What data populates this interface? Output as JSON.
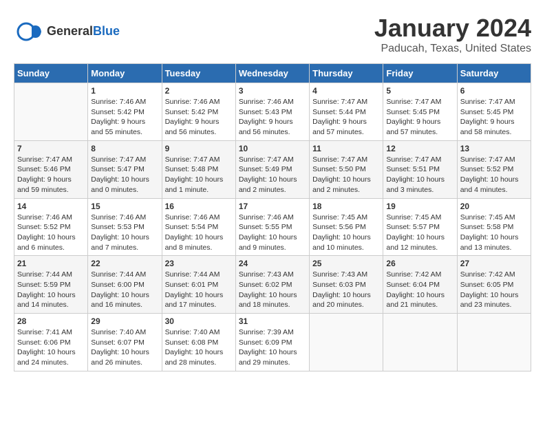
{
  "header": {
    "title": "January 2024",
    "subtitle": "Paducah, Texas, United States",
    "logo_line1": "General",
    "logo_line2": "Blue"
  },
  "days_of_week": [
    "Sunday",
    "Monday",
    "Tuesday",
    "Wednesday",
    "Thursday",
    "Friday",
    "Saturday"
  ],
  "weeks": [
    [
      {
        "date": "",
        "info": ""
      },
      {
        "date": "1",
        "info": "Sunrise: 7:46 AM\nSunset: 5:42 PM\nDaylight: 9 hours\nand 55 minutes."
      },
      {
        "date": "2",
        "info": "Sunrise: 7:46 AM\nSunset: 5:42 PM\nDaylight: 9 hours\nand 56 minutes."
      },
      {
        "date": "3",
        "info": "Sunrise: 7:46 AM\nSunset: 5:43 PM\nDaylight: 9 hours\nand 56 minutes."
      },
      {
        "date": "4",
        "info": "Sunrise: 7:47 AM\nSunset: 5:44 PM\nDaylight: 9 hours\nand 57 minutes."
      },
      {
        "date": "5",
        "info": "Sunrise: 7:47 AM\nSunset: 5:45 PM\nDaylight: 9 hours\nand 57 minutes."
      },
      {
        "date": "6",
        "info": "Sunrise: 7:47 AM\nSunset: 5:45 PM\nDaylight: 9 hours\nand 58 minutes."
      }
    ],
    [
      {
        "date": "7",
        "info": "Sunrise: 7:47 AM\nSunset: 5:46 PM\nDaylight: 9 hours\nand 59 minutes."
      },
      {
        "date": "8",
        "info": "Sunrise: 7:47 AM\nSunset: 5:47 PM\nDaylight: 10 hours\nand 0 minutes."
      },
      {
        "date": "9",
        "info": "Sunrise: 7:47 AM\nSunset: 5:48 PM\nDaylight: 10 hours\nand 1 minute."
      },
      {
        "date": "10",
        "info": "Sunrise: 7:47 AM\nSunset: 5:49 PM\nDaylight: 10 hours\nand 2 minutes."
      },
      {
        "date": "11",
        "info": "Sunrise: 7:47 AM\nSunset: 5:50 PM\nDaylight: 10 hours\nand 2 minutes."
      },
      {
        "date": "12",
        "info": "Sunrise: 7:47 AM\nSunset: 5:51 PM\nDaylight: 10 hours\nand 3 minutes."
      },
      {
        "date": "13",
        "info": "Sunrise: 7:47 AM\nSunset: 5:52 PM\nDaylight: 10 hours\nand 4 minutes."
      }
    ],
    [
      {
        "date": "14",
        "info": "Sunrise: 7:46 AM\nSunset: 5:52 PM\nDaylight: 10 hours\nand 6 minutes."
      },
      {
        "date": "15",
        "info": "Sunrise: 7:46 AM\nSunset: 5:53 PM\nDaylight: 10 hours\nand 7 minutes."
      },
      {
        "date": "16",
        "info": "Sunrise: 7:46 AM\nSunset: 5:54 PM\nDaylight: 10 hours\nand 8 minutes."
      },
      {
        "date": "17",
        "info": "Sunrise: 7:46 AM\nSunset: 5:55 PM\nDaylight: 10 hours\nand 9 minutes."
      },
      {
        "date": "18",
        "info": "Sunrise: 7:45 AM\nSunset: 5:56 PM\nDaylight: 10 hours\nand 10 minutes."
      },
      {
        "date": "19",
        "info": "Sunrise: 7:45 AM\nSunset: 5:57 PM\nDaylight: 10 hours\nand 12 minutes."
      },
      {
        "date": "20",
        "info": "Sunrise: 7:45 AM\nSunset: 5:58 PM\nDaylight: 10 hours\nand 13 minutes."
      }
    ],
    [
      {
        "date": "21",
        "info": "Sunrise: 7:44 AM\nSunset: 5:59 PM\nDaylight: 10 hours\nand 14 minutes."
      },
      {
        "date": "22",
        "info": "Sunrise: 7:44 AM\nSunset: 6:00 PM\nDaylight: 10 hours\nand 16 minutes."
      },
      {
        "date": "23",
        "info": "Sunrise: 7:44 AM\nSunset: 6:01 PM\nDaylight: 10 hours\nand 17 minutes."
      },
      {
        "date": "24",
        "info": "Sunrise: 7:43 AM\nSunset: 6:02 PM\nDaylight: 10 hours\nand 18 minutes."
      },
      {
        "date": "25",
        "info": "Sunrise: 7:43 AM\nSunset: 6:03 PM\nDaylight: 10 hours\nand 20 minutes."
      },
      {
        "date": "26",
        "info": "Sunrise: 7:42 AM\nSunset: 6:04 PM\nDaylight: 10 hours\nand 21 minutes."
      },
      {
        "date": "27",
        "info": "Sunrise: 7:42 AM\nSunset: 6:05 PM\nDaylight: 10 hours\nand 23 minutes."
      }
    ],
    [
      {
        "date": "28",
        "info": "Sunrise: 7:41 AM\nSunset: 6:06 PM\nDaylight: 10 hours\nand 24 minutes."
      },
      {
        "date": "29",
        "info": "Sunrise: 7:40 AM\nSunset: 6:07 PM\nDaylight: 10 hours\nand 26 minutes."
      },
      {
        "date": "30",
        "info": "Sunrise: 7:40 AM\nSunset: 6:08 PM\nDaylight: 10 hours\nand 28 minutes."
      },
      {
        "date": "31",
        "info": "Sunrise: 7:39 AM\nSunset: 6:09 PM\nDaylight: 10 hours\nand 29 minutes."
      },
      {
        "date": "",
        "info": ""
      },
      {
        "date": "",
        "info": ""
      },
      {
        "date": "",
        "info": ""
      }
    ]
  ]
}
